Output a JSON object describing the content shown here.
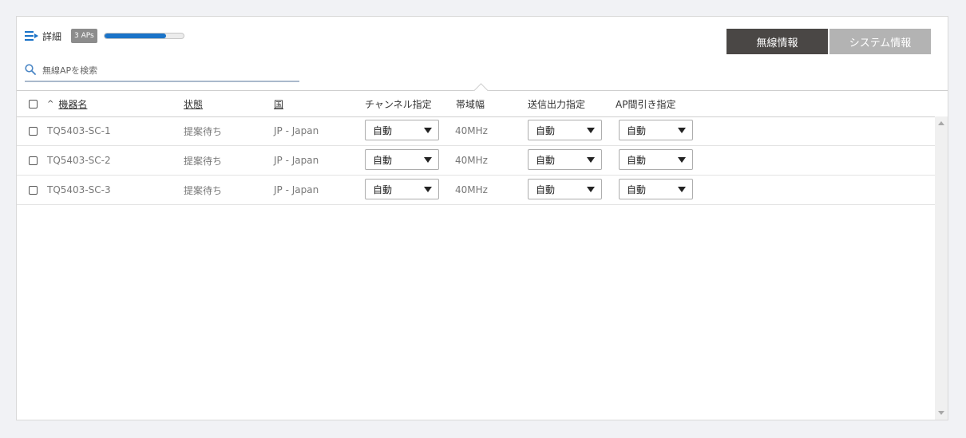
{
  "toolbar": {
    "detail_label": "詳細",
    "ap_count_badge": "3 APs",
    "progress_fraction": 0.78,
    "tabs": [
      {
        "label": "無線情報",
        "active": true
      },
      {
        "label": "システム情報",
        "active": false
      }
    ]
  },
  "search": {
    "placeholder": "無線APを検索",
    "value": ""
  },
  "table": {
    "columns": {
      "name": "機器名",
      "status": "状態",
      "country": "国",
      "channel": "チャンネル指定",
      "bandwidth": "帯域幅",
      "tx_power": "送信出力指定",
      "ap_thinning": "AP間引き指定"
    },
    "sort_indicator": "^",
    "rows": [
      {
        "name": "TQ5403-SC-1",
        "status": "提案待ち",
        "country": "JP - Japan",
        "channel": "自動",
        "bandwidth": "40MHz",
        "tx_power": "自動",
        "ap_thinning": "自動"
      },
      {
        "name": "TQ5403-SC-2",
        "status": "提案待ち",
        "country": "JP - Japan",
        "channel": "自動",
        "bandwidth": "40MHz",
        "tx_power": "自動",
        "ap_thinning": "自動"
      },
      {
        "name": "TQ5403-SC-3",
        "status": "提案待ち",
        "country": "JP - Japan",
        "channel": "自動",
        "bandwidth": "40MHz",
        "tx_power": "自動",
        "ap_thinning": "自動"
      }
    ]
  },
  "colors": {
    "accent": "#1a73c8",
    "active_tab": "#4a4745",
    "inactive_tab": "#b3b3b3",
    "badge": "#8c8c8c"
  }
}
